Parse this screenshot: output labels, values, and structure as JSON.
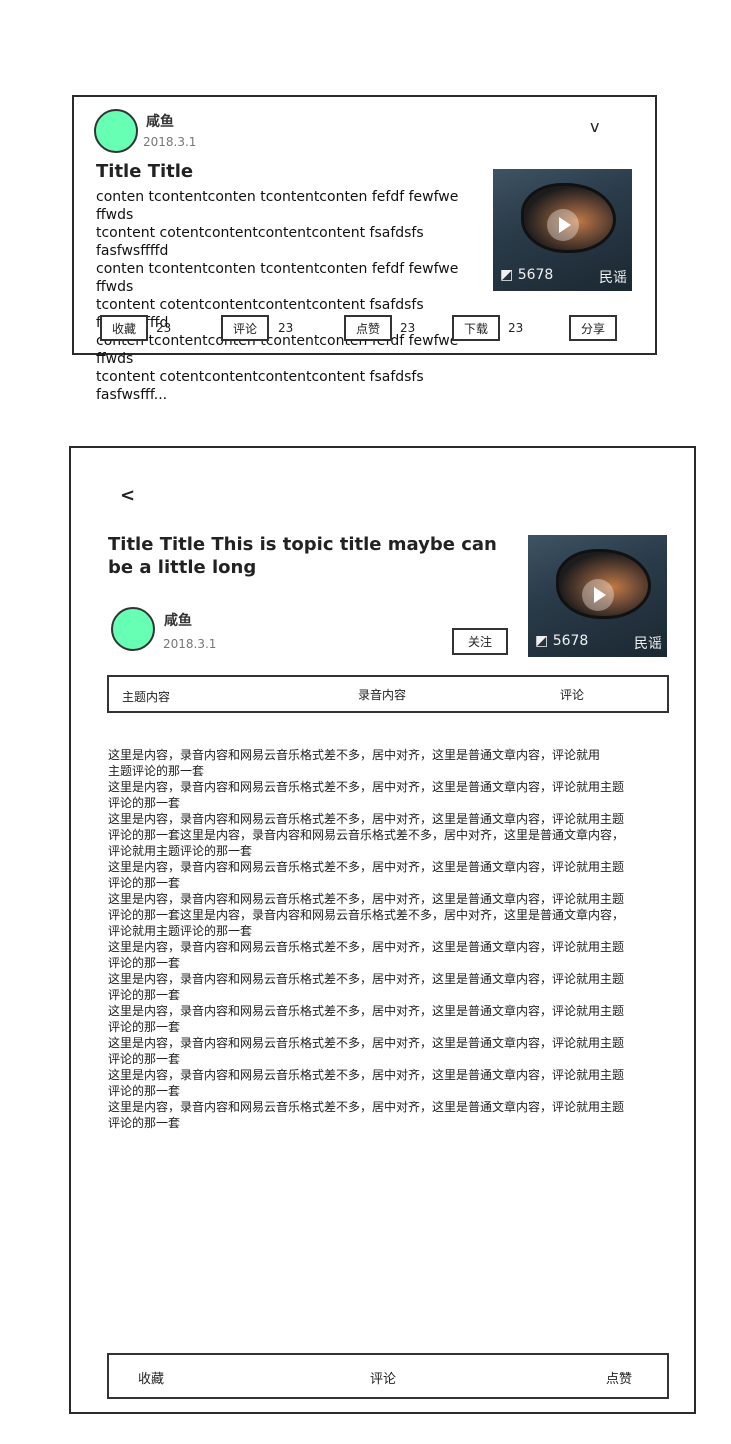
{
  "card": {
    "author": {
      "name": "咸鱼",
      "date": "2018.3.1"
    },
    "expand_icon": "chevron-down-icon",
    "expand_glyph": "v",
    "title": "Title Title",
    "content": "conten tcontentconten tcontentconten fefdf fewfwe\nffwds\ntcontent cotentcontentcontentcontent fsafdsfs\nfasfwsffffd\nconten tcontentconten tcontentconten fefdf fewfwe\nffwds\ntcontent cotentcontentcontentcontent fsafdsfs\nfasfwsffffd\nconten tcontentconten tcontentconten fefdf fewfwe\nffwds\ntcontent cotentcontentcontentcontent fsafdsfs\nfasfwsfff...",
    "thumbnail": {
      "play_count": "5678",
      "tag": "民谣",
      "headphone_icon": "headphone-icon",
      "play_icon": "play-icon"
    },
    "actions": [
      {
        "label": "收藏",
        "count": "23"
      },
      {
        "label": "评论",
        "count": "23"
      },
      {
        "label": "点赞",
        "count": "23"
      },
      {
        "label": "下载",
        "count": "23"
      },
      {
        "label": "分享",
        "count": ""
      }
    ]
  },
  "detail": {
    "back_glyph": "<",
    "back_icon": "back-arrow-icon",
    "title": "Title Title This is topic title maybe can be a little long",
    "author": {
      "name": "咸鱼",
      "date": "2018.3.1"
    },
    "follow_label": "关注",
    "thumbnail": {
      "play_count": "5678",
      "tag": "民谣"
    },
    "tabs": [
      "主题内容",
      "录音内容",
      "评论"
    ],
    "article": "    这里是内容，录音内容和网易云音乐格式差不多，居中对齐，这里是普通文章内容，评论就用\n主题评论的那一套\n这里是内容，录音内容和网易云音乐格式差不多，居中对齐，这里是普通文章内容，评论就用主题\n评论的那一套\n这里是内容，录音内容和网易云音乐格式差不多，居中对齐，这里是普通文章内容，评论就用主题\n评论的那一套这里是内容，录音内容和网易云音乐格式差不多，居中对齐，这里是普通文章内容，\n评论就用主题评论的那一套\n这里是内容，录音内容和网易云音乐格式差不多，居中对齐，这里是普通文章内容，评论就用主题\n评论的那一套\n这里是内容，录音内容和网易云音乐格式差不多，居中对齐，这里是普通文章内容，评论就用主题\n评论的那一套这里是内容，录音内容和网易云音乐格式差不多，居中对齐，这里是普通文章内容，\n评论就用主题评论的那一套\n这里是内容，录音内容和网易云音乐格式差不多，居中对齐，这里是普通文章内容，评论就用主题\n评论的那一套\n这里是内容，录音内容和网易云音乐格式差不多，居中对齐，这里是普通文章内容，评论就用主题\n评论的那一套\n这里是内容，录音内容和网易云音乐格式差不多，居中对齐，这里是普通文章内容，评论就用主题\n评论的那一套\n这里是内容，录音内容和网易云音乐格式差不多，居中对齐，这里是普通文章内容，评论就用主题\n评论的那一套\n这里是内容，录音内容和网易云音乐格式差不多，居中对齐，这里是普通文章内容，评论就用主题\n评论的那一套\n这里是内容，录音内容和网易云音乐格式差不多，居中对齐，这里是普通文章内容，评论就用主题\n评论的那一套",
    "bottom_actions": [
      "收藏",
      "评论",
      "点赞"
    ]
  },
  "colors": {
    "avatar": "#66ffb3",
    "border": "#2b2b2b"
  }
}
